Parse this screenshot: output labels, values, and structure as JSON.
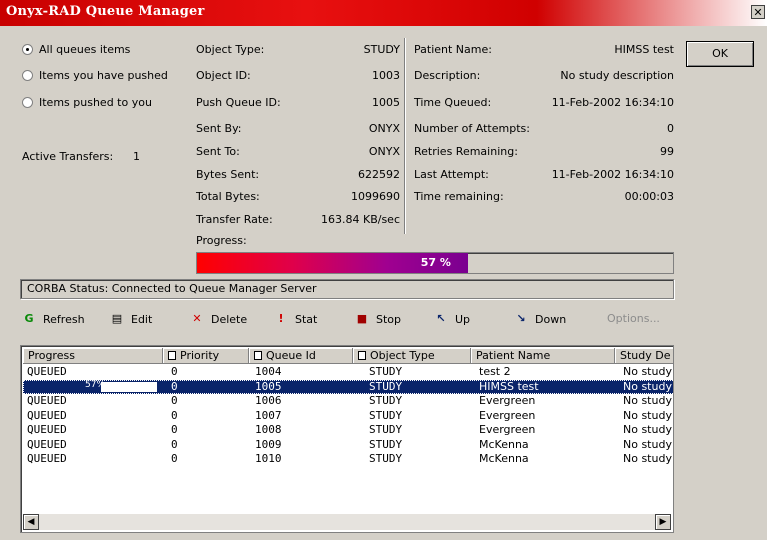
{
  "window": {
    "title": "Onyx-RAD Queue Manager",
    "close_glyph": "✕"
  },
  "filters": [
    {
      "label": "All queues items",
      "selected": true
    },
    {
      "label": "Items you have pushed",
      "selected": false
    },
    {
      "label": "Items pushed to you",
      "selected": false
    }
  ],
  "active_transfers": {
    "label": "Active Transfers:",
    "value": "1"
  },
  "details_left": [
    {
      "label": "Object Type:",
      "value": "STUDY"
    },
    {
      "label": "Object ID:",
      "value": "1003"
    },
    {
      "label": "Push Queue ID:",
      "value": "1005"
    },
    {
      "label": "Sent By:",
      "value": "ONYX"
    },
    {
      "label": "Sent To:",
      "value": "ONYX"
    },
    {
      "label": "Bytes Sent:",
      "value": "622592"
    },
    {
      "label": "Total Bytes:",
      "value": "1099690"
    },
    {
      "label": "Transfer Rate:",
      "value": "163.84 KB/sec"
    },
    {
      "label": "Progress:",
      "value": ""
    }
  ],
  "details_right": [
    {
      "label": "Patient Name:",
      "value": "HIMSS test"
    },
    {
      "label": "Description:",
      "value": "No study description"
    },
    {
      "label": "Time Queued:",
      "value": "11-Feb-2002 16:34:10"
    },
    {
      "label": "Number of Attempts:",
      "value": "0"
    },
    {
      "label": "Retries Remaining:",
      "value": "99"
    },
    {
      "label": "Last Attempt:",
      "value": "11-Feb-2002 16:34:10"
    },
    {
      "label": "Time remaining:",
      "value": "00:00:03"
    }
  ],
  "ok_label": "OK",
  "progress": {
    "fraction": 0.57,
    "label": "57 %"
  },
  "status": "CORBA Status: Connected to Queue Manager Server",
  "toolbar": [
    {
      "label": "Refresh",
      "icon": "refresh-icon",
      "glyph": "G",
      "color": "#0a8a0a",
      "enabled": true
    },
    {
      "label": "Edit",
      "icon": "edit-icon",
      "glyph": "▤",
      "color": "#000000",
      "enabled": true
    },
    {
      "label": "Delete",
      "icon": "delete-icon",
      "glyph": "✕",
      "color": "#d00000",
      "enabled": true
    },
    {
      "label": "Stat",
      "icon": "stat-icon",
      "glyph": "!",
      "color": "#d00000",
      "enabled": true
    },
    {
      "label": "Stop",
      "icon": "stop-icon",
      "glyph": "■",
      "color": "#a00000",
      "enabled": true
    },
    {
      "label": "Up",
      "icon": "up-arrow-icon",
      "glyph": "↖",
      "color": "#0a246a",
      "enabled": true
    },
    {
      "label": "Down",
      "icon": "down-arrow-icon",
      "glyph": "↘",
      "color": "#0a246a",
      "enabled": true
    },
    {
      "label": "Options...",
      "icon": "",
      "glyph": "",
      "color": "#8c8c8c",
      "enabled": false
    }
  ],
  "table": {
    "columns": [
      "Progress",
      "Priority",
      "Queue Id",
      "Object Type",
      "Patient Name",
      "Study De"
    ],
    "rows": [
      {
        "progress": "QUEUED",
        "priority": "0",
        "queue_id": "1004",
        "object_type": "STUDY",
        "patient": "test 2",
        "study": "No study",
        "selected": false
      },
      {
        "progress": "57%",
        "progress_fraction": 0.57,
        "priority": "0",
        "queue_id": "1005",
        "object_type": "STUDY",
        "patient": "HIMSS test",
        "study": "No study",
        "selected": true
      },
      {
        "progress": "QUEUED",
        "priority": "0",
        "queue_id": "1006",
        "object_type": "STUDY",
        "patient": "Evergreen",
        "study": "No study",
        "selected": false
      },
      {
        "progress": "QUEUED",
        "priority": "0",
        "queue_id": "1007",
        "object_type": "STUDY",
        "patient": "Evergreen",
        "study": "No study",
        "selected": false
      },
      {
        "progress": "QUEUED",
        "priority": "0",
        "queue_id": "1008",
        "object_type": "STUDY",
        "patient": "Evergreen",
        "study": "No study",
        "selected": false
      },
      {
        "progress": "QUEUED",
        "priority": "0",
        "queue_id": "1009",
        "object_type": "STUDY",
        "patient": "McKenna",
        "study": "No study",
        "selected": false
      },
      {
        "progress": "QUEUED",
        "priority": "0",
        "queue_id": "1010",
        "object_type": "STUDY",
        "patient": "McKenna",
        "study": "No study",
        "selected": false
      }
    ]
  }
}
